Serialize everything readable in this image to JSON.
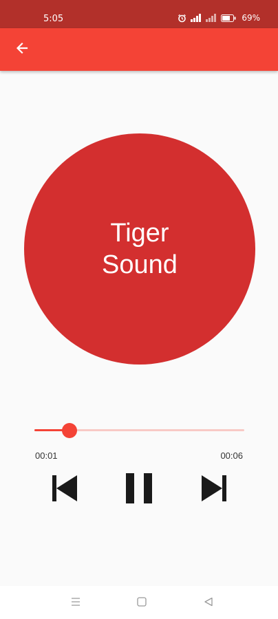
{
  "status_bar": {
    "time": "5:05",
    "battery": "69%"
  },
  "app_bar": {
    "back_icon": "arrow-left-icon",
    "color": "#f44336"
  },
  "player": {
    "title": "Tiger Sound",
    "disc_color": "#d32f2f",
    "progress_fraction": 0.167,
    "current_time": "00:01",
    "total_time": "00:06",
    "controls": [
      "skip-previous-icon",
      "pause-icon",
      "skip-next-icon"
    ]
  },
  "nav_bar": {
    "icons": [
      "menu-icon",
      "home-square-icon",
      "back-triangle-icon"
    ]
  }
}
